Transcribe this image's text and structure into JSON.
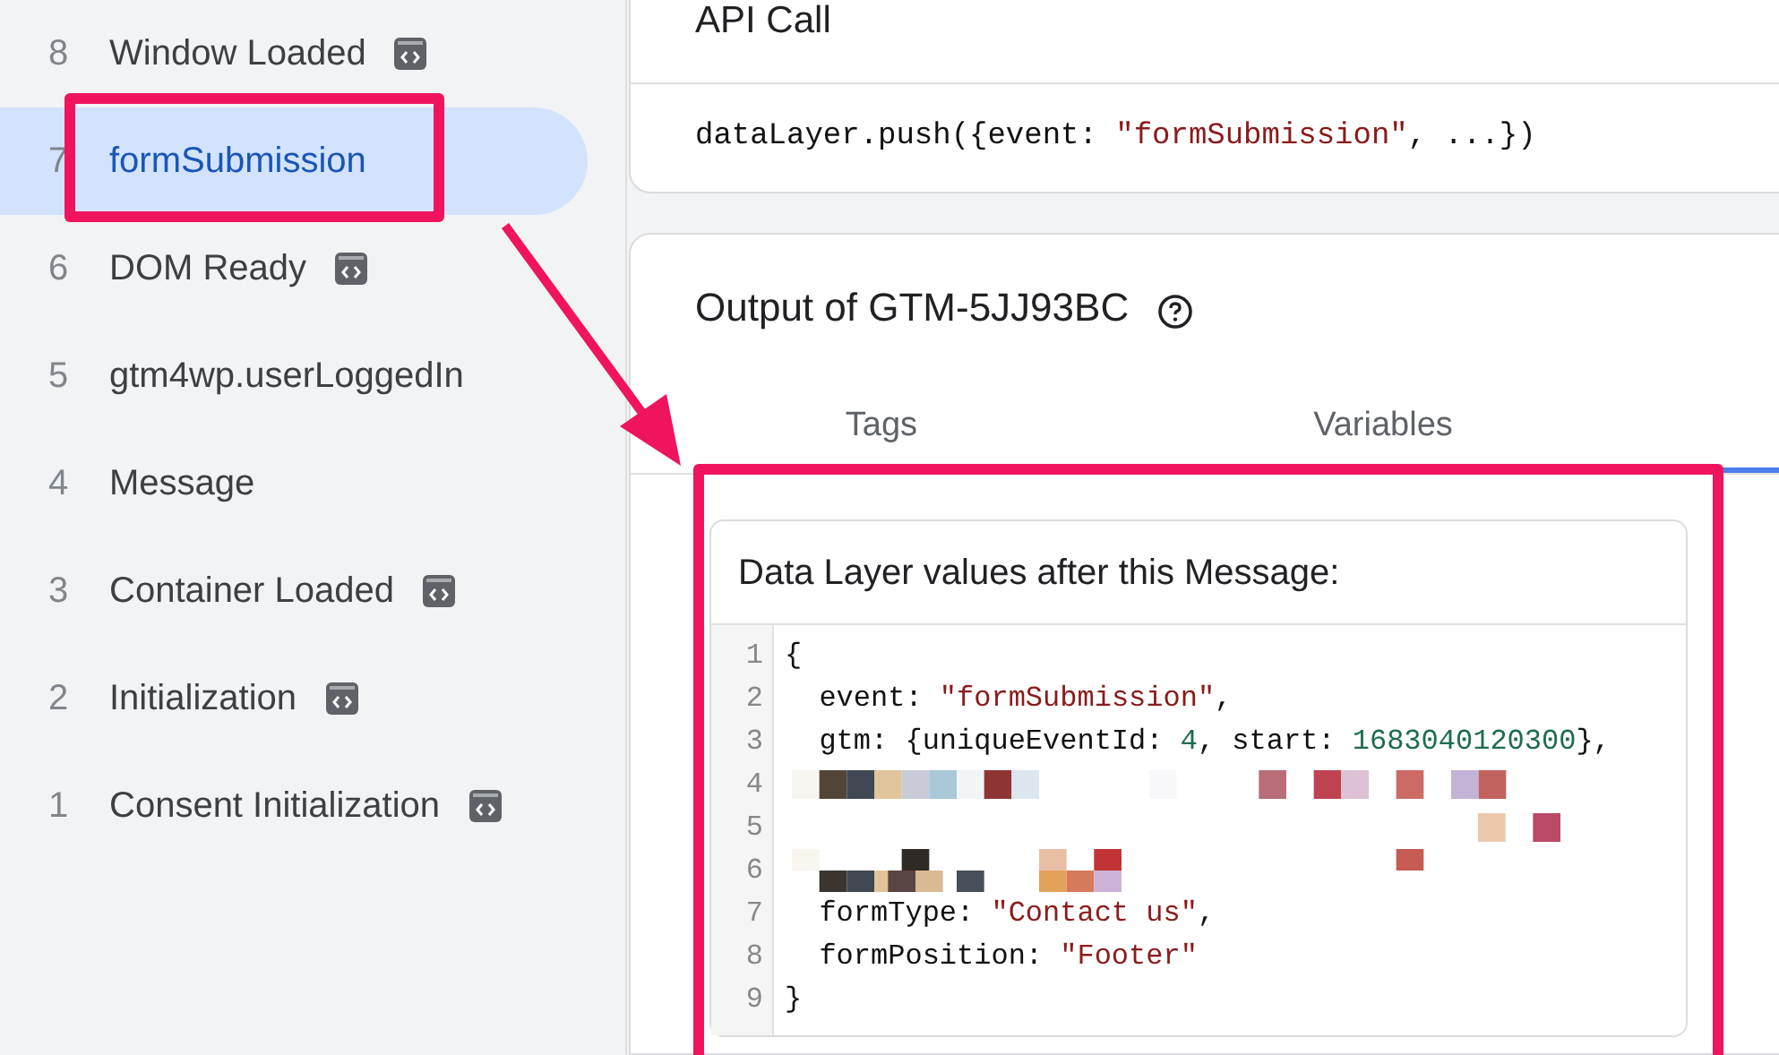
{
  "sidebar": {
    "items": [
      {
        "number": "8",
        "label": "Window Loaded",
        "icon": true,
        "selected": false
      },
      {
        "number": "7",
        "label": "formSubmission",
        "icon": false,
        "selected": true
      },
      {
        "number": "6",
        "label": "DOM Ready",
        "icon": true,
        "selected": false
      },
      {
        "number": "5",
        "label": "gtm4wp.userLoggedIn",
        "icon": false,
        "selected": false
      },
      {
        "number": "4",
        "label": "Message",
        "icon": false,
        "selected": false
      },
      {
        "number": "3",
        "label": "Container Loaded",
        "icon": true,
        "selected": false
      },
      {
        "number": "2",
        "label": "Initialization",
        "icon": true,
        "selected": false
      },
      {
        "number": "1",
        "label": "Consent Initialization",
        "icon": true,
        "selected": false
      }
    ]
  },
  "api_call": {
    "title": "API Call",
    "code": [
      {
        "kind": "plain",
        "text": "dataLayer.push({event: "
      },
      {
        "kind": "string",
        "text": "\"formSubmission\""
      },
      {
        "kind": "plain",
        "text": ", ...})"
      }
    ]
  },
  "output": {
    "title": "Output of GTM-5JJ93BC",
    "tabs": [
      {
        "label": "Tags",
        "selected": false
      },
      {
        "label": "Variables",
        "selected": false
      }
    ],
    "data_layer": {
      "title": "Data Layer values after this Message:",
      "lines": [
        {
          "number": "1",
          "kind": "code",
          "tokens": [
            {
              "kind": "plain",
              "text": "{"
            }
          ]
        },
        {
          "number": "2",
          "kind": "code",
          "tokens": [
            {
              "kind": "plain",
              "text": "  event: "
            },
            {
              "kind": "string",
              "text": "\"formSubmission\""
            },
            {
              "kind": "plain",
              "text": ","
            }
          ]
        },
        {
          "number": "3",
          "kind": "code",
          "tokens": [
            {
              "kind": "plain",
              "text": "  gtm: {uniqueEventId: "
            },
            {
              "kind": "number",
              "text": "4"
            },
            {
              "kind": "plain",
              "text": ", start: "
            },
            {
              "kind": "number",
              "text": "1683040120300"
            },
            {
              "kind": "plain",
              "text": "},"
            }
          ]
        },
        {
          "number": "4",
          "kind": "redacted"
        },
        {
          "number": "5",
          "kind": "redacted"
        },
        {
          "number": "6",
          "kind": "redacted"
        },
        {
          "number": "7",
          "kind": "code",
          "tokens": [
            {
              "kind": "plain",
              "text": "  formType: "
            },
            {
              "kind": "string",
              "text": "\"Contact us\""
            },
            {
              "kind": "plain",
              "text": ","
            }
          ]
        },
        {
          "number": "8",
          "kind": "code",
          "tokens": [
            {
              "kind": "plain",
              "text": "  formPosition: "
            },
            {
              "kind": "string",
              "text": "\"Footer\""
            }
          ]
        },
        {
          "number": "9",
          "kind": "code",
          "tokens": [
            {
              "kind": "plain",
              "text": "}"
            }
          ]
        }
      ]
    }
  }
}
